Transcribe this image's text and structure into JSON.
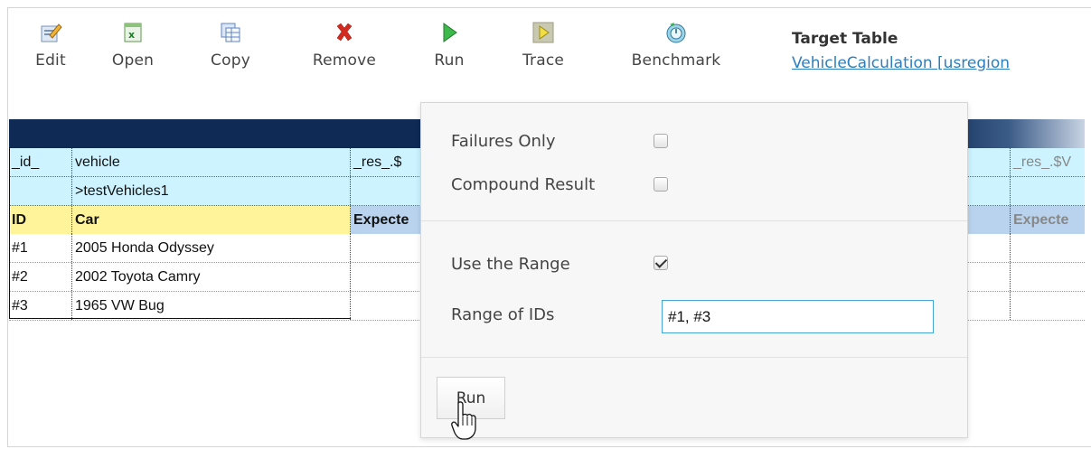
{
  "toolbar": {
    "items": [
      {
        "label": "Edit",
        "icon": "edit-icon"
      },
      {
        "label": "Open",
        "icon": "excel-open-icon"
      },
      {
        "label": "Copy",
        "icon": "copy-table-icon"
      },
      {
        "label": "Remove",
        "icon": "remove-x-icon"
      },
      {
        "label": "Run",
        "icon": "play-icon"
      },
      {
        "label": "Trace",
        "icon": "trace-icon"
      },
      {
        "label": "Benchmark",
        "icon": "benchmark-icon"
      }
    ],
    "target_title": "Target Table",
    "target_link": "VehicleCalculation [usregion"
  },
  "grid": {
    "vars_row": {
      "c1": "_id_",
      "c2": "vehicle",
      "c3": "_res_.$",
      "c4": "_res_.$V"
    },
    "plist_row": {
      "c2": ">testVehicles1"
    },
    "label_row": {
      "c1": "ID",
      "c2": "Car",
      "c3": "Expecte",
      "c4": "Expecte"
    },
    "rows": [
      {
        "id": "#1",
        "car": "2005 Honda Odyssey"
      },
      {
        "id": "#2",
        "car": "2002 Toyota Camry"
      },
      {
        "id": "#3",
        "car": "1965 VW Bug"
      }
    ]
  },
  "popup": {
    "failures_only": {
      "label": "Failures Only",
      "checked": false
    },
    "compound_result": {
      "label": "Compound Result",
      "checked": false
    },
    "use_range": {
      "label": "Use the Range",
      "checked": true
    },
    "range_ids": {
      "label": "Range of IDs",
      "value": "#1, #3"
    },
    "run_button": "Run"
  },
  "colors": {
    "header_bar": "#0e2a55",
    "variables_row": "#ccf3ff",
    "label_row": "#fff49a",
    "link": "#2b7fc0",
    "input_border": "#46a6d6"
  }
}
